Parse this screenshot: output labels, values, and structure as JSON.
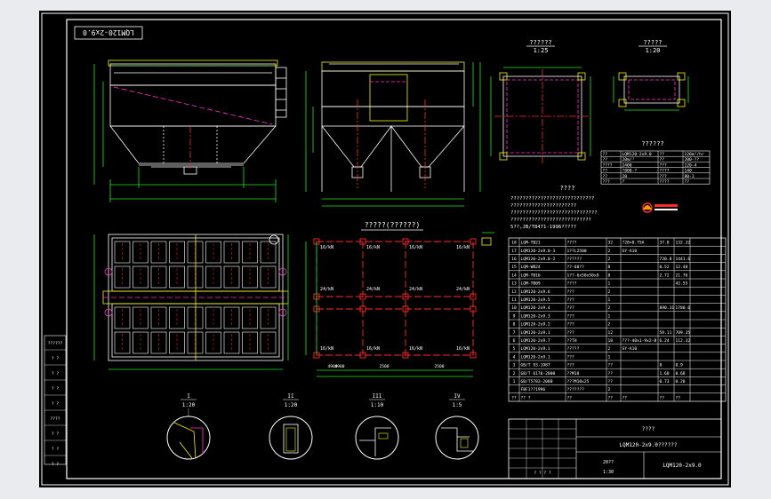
{
  "colors": {
    "background": "#000000",
    "frame": "#ffffff",
    "cyan": "#18e6e6",
    "red": "#ff2a2a",
    "magenta": "#ff33cc",
    "yellow": "#f5f500",
    "green": "#1ee61e",
    "white": "#ffffff"
  },
  "rotated_title": "LQM120-2x9.0",
  "scale_top_right": {
    "caption": "??????",
    "ratio": "1:25"
  },
  "scale_small": {
    "caption": "?????",
    "ratio": "1:20"
  },
  "plan_title": "?????(??????)",
  "tech_req_title": "????",
  "tech_req_lines": [
    "????????????????????????????",
    "??????????????????????",
    "?????????????????????????????",
    "???????????????????????????",
    "5??,JB/T8471-1996?????"
  ],
  "spec_title": "??????",
  "spec_rows": [
    [
      "??",
      "LQM120-2x9.0",
      "??",
      "120m²/hr"
    ],
    [
      "??",
      "20m/³",
      "??",
      "200-??"
    ],
    [
      "????",
      "2400",
      "???",
      "120-4"
    ],
    [
      "??",
      "?800-?",
      "????",
      "140"
    ],
    [
      "??",
      "20",
      "???",
      "80-1"
    ],
    [
      "???",
      "?",
      "????",
      "??"
    ]
  ],
  "loads": [
    [
      "16/kN",
      "16/kN",
      "16/kN",
      "16/kN"
    ],
    [
      "24/kN",
      "24/kN",
      "24/kN",
      "24/kN"
    ],
    [
      "16/kN",
      "16/kN",
      "16/kN",
      "16/kN"
    ]
  ],
  "plan_dims": [
    "4900",
    "2500",
    "2500",
    "4900"
  ],
  "section_labels": [
    {
      "mark": "I",
      "scale": "1:20"
    },
    {
      "mark": "II",
      "scale": "1:20"
    },
    {
      "mark": "III",
      "scale": "1:10"
    },
    {
      "mark": "IV",
      "scale": "1:5"
    }
  ],
  "bom": [
    [
      "18",
      "LQM-TB21",
      "????",
      "32",
      "?28×0.75A",
      "37.8",
      "132.32"
    ],
    [
      "17",
      "LQM120-2x9.0-3",
      "1??L2500",
      "2",
      "SY-A10",
      "",
      ""
    ],
    [
      "16",
      "LQM120-2x9.0-2",
      "??????",
      "2",
      "",
      "720.8",
      "1441.6"
    ],
    [
      "15",
      "LQM-WB24",
      "??-60??",
      "8",
      "",
      "0.52",
      "12.48"
    ],
    [
      "14",
      "LQM-TB16",
      "1??-6x50x50x8",
      "8",
      "",
      "2.72",
      "21.76"
    ],
    [
      "13",
      "LQM-TB09",
      "????",
      "1",
      "",
      "",
      "42.55"
    ],
    [
      "12",
      "LQM120-2x9.6",
      "???",
      "2",
      "",
      "",
      ""
    ],
    [
      "11",
      "LQM120-2x9.5",
      "???",
      "1",
      "",
      "",
      ""
    ],
    [
      "10",
      "LQM120-2x9.4",
      "???",
      "2",
      "",
      "890.31",
      "1780.6"
    ],
    [
      "9",
      "LQM120-2x9.3",
      "???",
      "1",
      "",
      "",
      ""
    ],
    [
      "8",
      "LQM120-2x9.2",
      "???",
      "2",
      "",
      "",
      ""
    ],
    [
      "7",
      "LQM120-2x9.1",
      "???",
      "12",
      "",
      "59.11",
      "709.35"
    ],
    [
      "6",
      "LQM120-2x9.7",
      "??TH",
      "18",
      "???-40x1-9x2-B",
      "6.24",
      "112.32"
    ],
    [
      "5",
      "LQM120-2x9.1",
      "?????",
      "2",
      "SY-A10",
      "",
      ""
    ],
    [
      "4",
      "LQM120-2x9.1",
      "???",
      "1",
      "",
      "",
      ""
    ],
    [
      "3",
      "GB/T 93-1987",
      "???",
      "??",
      "",
      "8",
      "0.9"
    ],
    [
      "2",
      "GB/T 6170-2000",
      "??M10",
      "??",
      "",
      "1.60",
      "0.68"
    ],
    [
      "1",
      "GB/T5783-2000",
      "???M10x25",
      "??",
      "",
      "0.73",
      "0.28"
    ],
    [
      "",
      "FBF1??1996",
      "???????",
      "2",
      "",
      "",
      ""
    ],
    [
      "??",
      "?? ?",
      "??",
      "??",
      "??",
      "??",
      "??"
    ]
  ],
  "title_block": {
    "drawing_title": "LQM120-2x9.0??????",
    "drawing_no": "LQM120-2x9.0",
    "company": "????",
    "weight": "20??",
    "scale": "1:30",
    "sheets": "? ? ? ?"
  },
  "left_stamp": [
    "??????",
    "? ?",
    "? ?",
    "? ?",
    "? ?",
    "????",
    "? ?",
    "? ?",
    "? ?"
  ]
}
